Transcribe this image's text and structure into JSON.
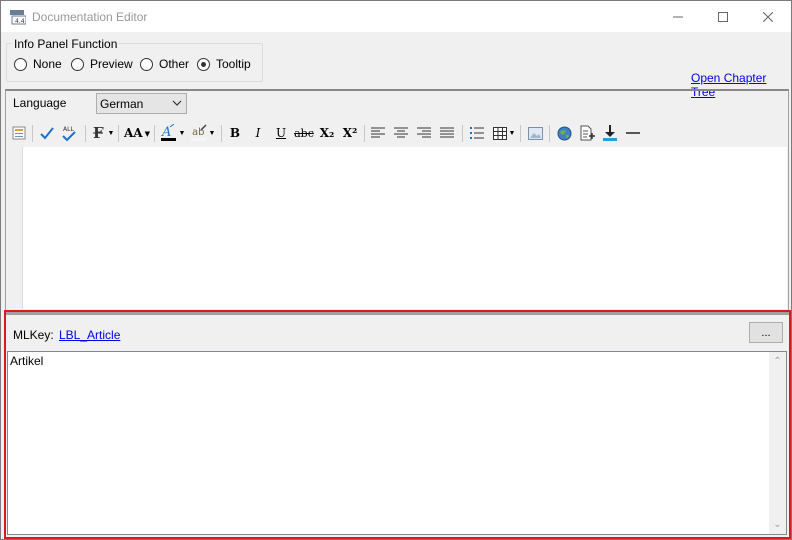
{
  "window": {
    "title": "Documentation Editor"
  },
  "info_panel": {
    "group_label": "Info Panel Function",
    "options": [
      {
        "label": "None",
        "selected": false
      },
      {
        "label": "Preview",
        "selected": false
      },
      {
        "label": "Other",
        "selected": false
      },
      {
        "label": "Tooltip",
        "selected": true
      }
    ]
  },
  "links": {
    "open_chapter_tree": "Open Chapter Tree"
  },
  "language": {
    "label": "Language",
    "selected": "German"
  },
  "toolbar": {
    "bold": "B",
    "italic": "I",
    "underline": "U",
    "strike": "abc",
    "subscript": "X₂",
    "superscript": "X²",
    "font_size": "AA"
  },
  "mlkey": {
    "label": "MLKey:",
    "value": "LBL_Article",
    "browse_label": "..."
  },
  "content": {
    "text": "Artikel"
  },
  "colors": {
    "highlight": "#e0161b",
    "link": "#0000ee",
    "accent_blue": "#1e72c8"
  }
}
